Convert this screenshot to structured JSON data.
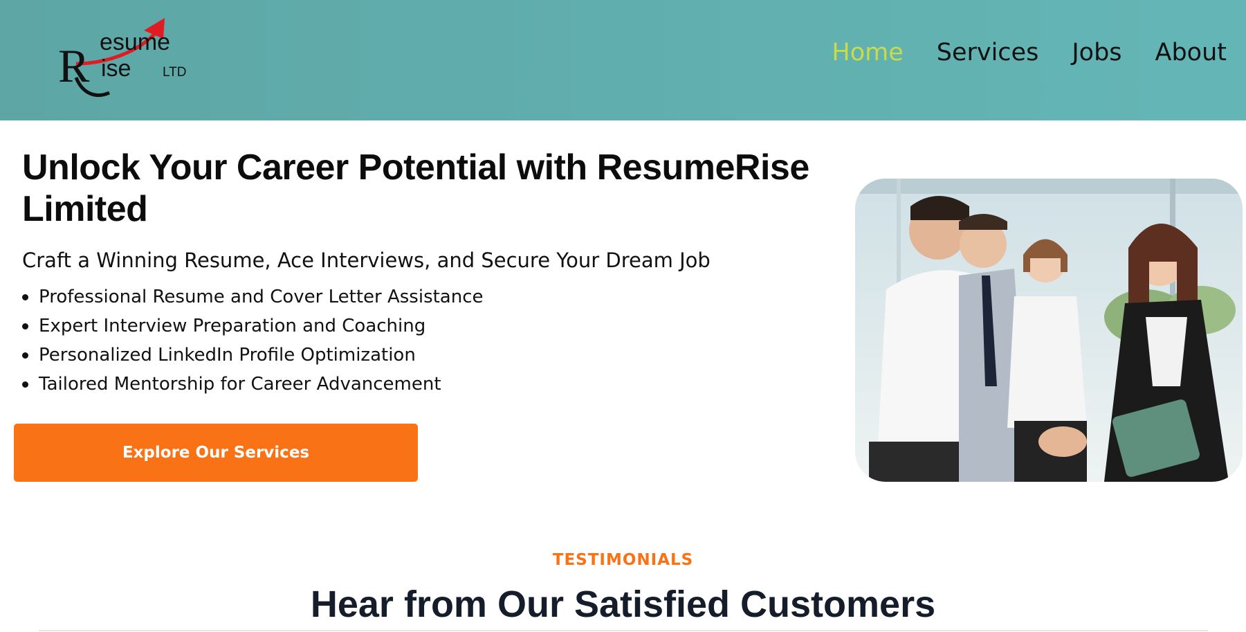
{
  "brand": {
    "logo_letter_r1": "R",
    "logo_top": "esume",
    "logo_letter_r2": "R",
    "logo_bottom": "ise",
    "logo_suffix": "LTD",
    "colors": {
      "header_bg": "#62b0b0",
      "arrow": "#e01b24",
      "accent": "#f97316",
      "active_nav": "#c8dc4a"
    }
  },
  "nav": {
    "items": [
      {
        "label": "Home",
        "active": true
      },
      {
        "label": "Services",
        "active": false
      },
      {
        "label": "Jobs",
        "active": false
      },
      {
        "label": "About",
        "active": false
      }
    ]
  },
  "hero": {
    "title": "Unlock Your Career Potential with ResumeRise Limited",
    "subtitle": "Craft a Winning Resume, Ace Interviews, and Secure Your Dream Job",
    "features": [
      "Professional Resume and Cover Letter Assistance",
      "Expert Interview Preparation and Coaching",
      "Personalized LinkedIn Profile Optimization",
      "Tailored Mentorship for Career Advancement"
    ],
    "cta_label": "Explore Our Services",
    "image_icon": "business-handshake-photo"
  },
  "testimonials": {
    "label": "TESTIMONIALS",
    "title": "Hear from Our Satisfied Customers"
  }
}
